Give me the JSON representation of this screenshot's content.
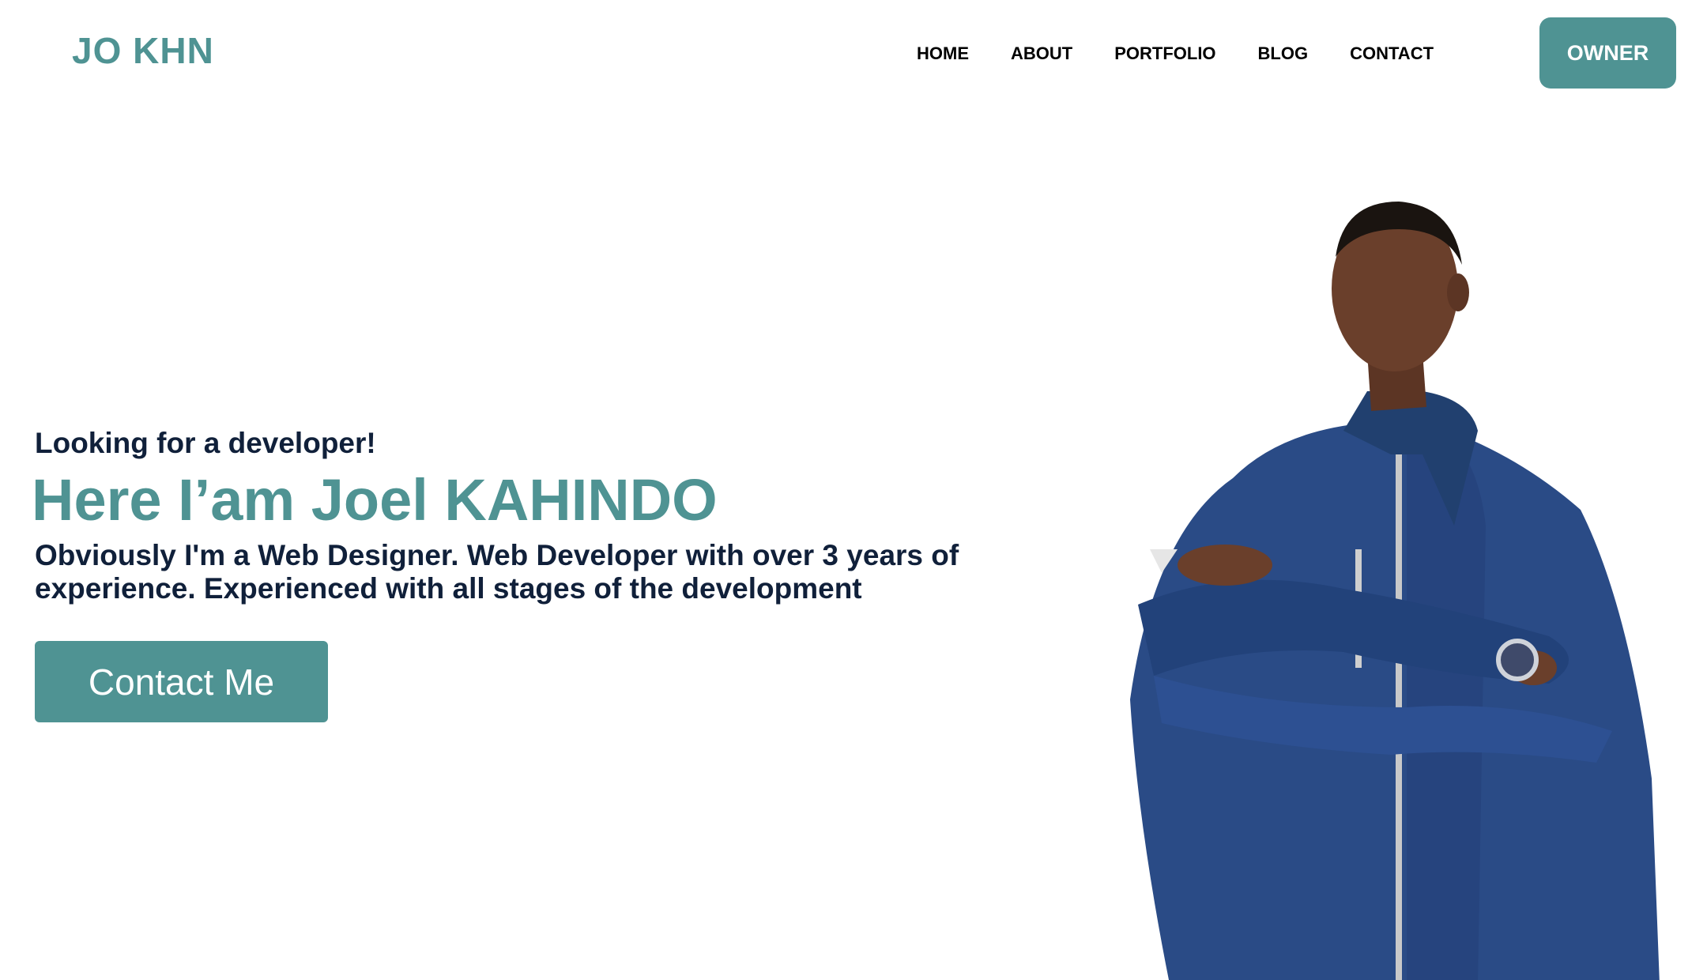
{
  "header": {
    "logo": "JO KHN",
    "nav": [
      "HOME",
      "ABOUT",
      "PORTFOLIO",
      "BLOG",
      "CONTACT"
    ],
    "owner_label": "OWNER"
  },
  "hero": {
    "tagline": "Looking for a developer!",
    "headline": "Here I’am Joel KAHINDO",
    "description": "Obviously I'm a Web Designer. Web Developer with over 3 years of experience. Experienced with all stages of the development",
    "cta_label": "Contact Me"
  },
  "colors": {
    "accent": "#4f9393",
    "text_dark": "#10203a",
    "jacket": "#2a4b86",
    "skin": "#6a3f2b"
  },
  "icons": {
    "portrait": "person-photo"
  }
}
